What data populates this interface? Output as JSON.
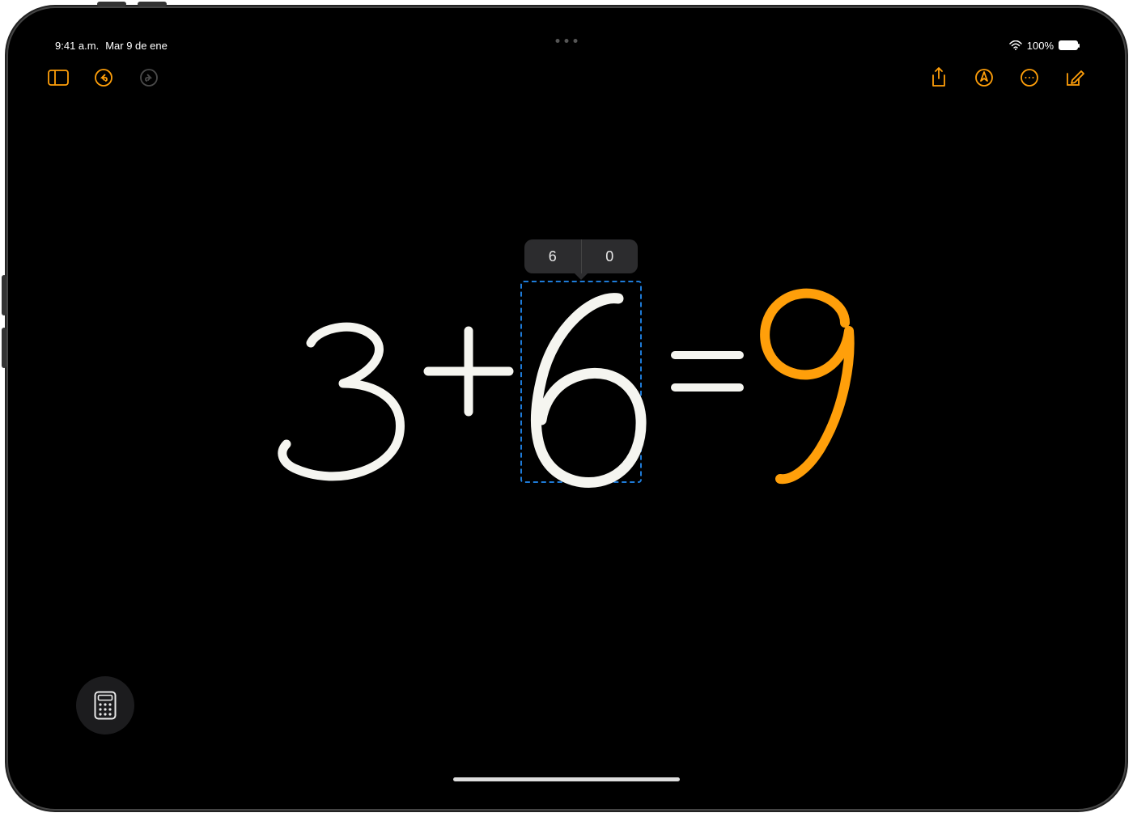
{
  "status": {
    "time": "9:41 a.m.",
    "date": "Mar 9 de ene",
    "battery_text": "100%"
  },
  "title": {
    "main": "",
    "sub": ""
  },
  "suggestions": {
    "opt1": "6",
    "opt2": "0"
  },
  "equation": {
    "term1": "3",
    "operator": "+",
    "term2": "6",
    "equals": "=",
    "result": "9"
  },
  "colors": {
    "accent": "#ff9f0a",
    "selection": "#1e7bd8",
    "ink_white": "#f5f5f0",
    "ink_orange": "#ff9f0a"
  },
  "icons": {
    "sidebar": "sidebar-icon",
    "undo": "undo-icon",
    "redo": "redo-icon",
    "share": "share-icon",
    "markup": "markup-icon",
    "more": "more-icon",
    "compose": "compose-icon",
    "calculator": "calculator-icon",
    "wifi": "wifi-icon"
  }
}
